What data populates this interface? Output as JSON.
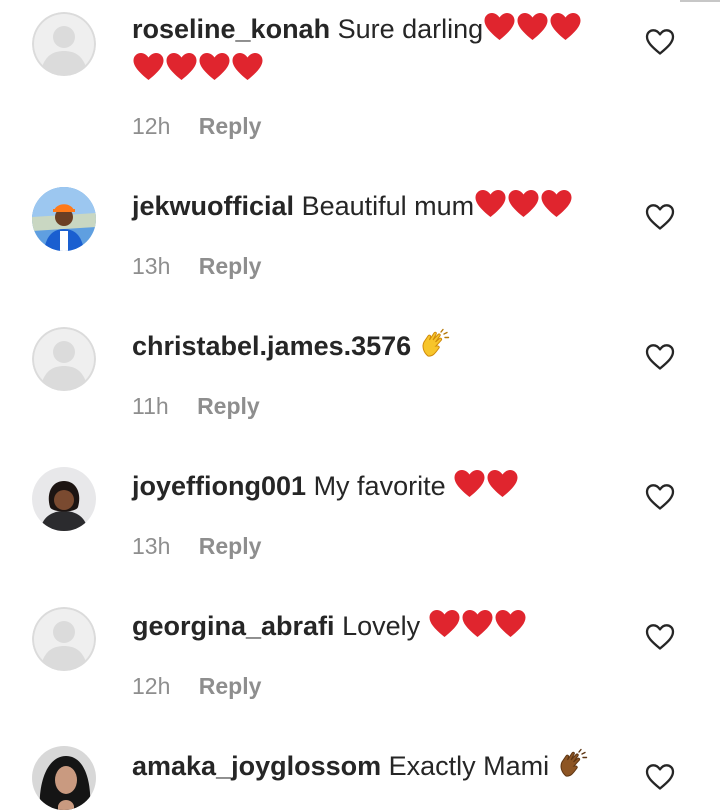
{
  "comments": [
    {
      "username": "roseline_konah",
      "text": "Sure darling",
      "emoji": "❤️❤️❤️❤️❤️❤️❤️",
      "time": "12h",
      "reply": "Reply",
      "avatar": "default-avatar"
    },
    {
      "username": "jekwuofficial",
      "text": "Beautiful mum",
      "emoji": "❤️❤️❤️",
      "time": "13h",
      "reply": "Reply",
      "avatar": "photo-avatar"
    },
    {
      "username": "christabel.james.3576",
      "text": "",
      "emoji": "👏",
      "time": "11h",
      "reply": "Reply",
      "avatar": "default-avatar"
    },
    {
      "username": "joyeffiong001",
      "text": "My favorite",
      "emoji": "❤️❤️",
      "time": "13h",
      "reply": "Reply",
      "avatar": "photo-avatar"
    },
    {
      "username": "georgina_abrafi",
      "text": "Lovely",
      "emoji": "❤️❤️❤️",
      "time": "12h",
      "reply": "Reply",
      "avatar": "default-avatar"
    },
    {
      "username": "amaka_joyglossom",
      "text": "Exactly Mami",
      "emoji": "👏🏾",
      "time": "",
      "reply": "",
      "avatar": "photo-avatar"
    }
  ],
  "icons": {
    "like": "heart-outline-icon",
    "heart_emoji": "red-heart-emoji",
    "clap_emoji": "clapping-hands-emoji"
  },
  "colors": {
    "username": "#262626",
    "meta": "#8e8e8e",
    "heart": "#e0252e",
    "default_avatar_bg": "#dbdbdb"
  }
}
